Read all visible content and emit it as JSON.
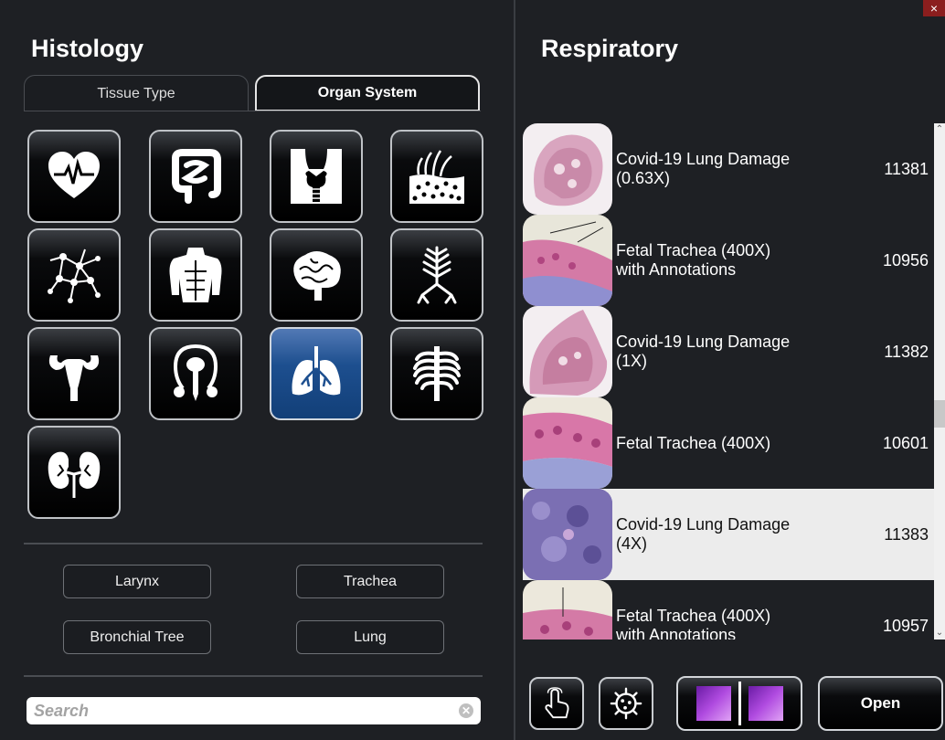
{
  "left": {
    "title": "Histology",
    "tabs": [
      {
        "label": "Tissue Type",
        "active": false
      },
      {
        "label": "Organ System",
        "active": true
      }
    ],
    "organ_systems": [
      {
        "icon": "heart-icon"
      },
      {
        "icon": "intestine-icon"
      },
      {
        "icon": "thyroid-icon"
      },
      {
        "icon": "skin-icon"
      },
      {
        "icon": "lymphatic-icon"
      },
      {
        "icon": "muscle-icon"
      },
      {
        "icon": "brain-icon"
      },
      {
        "icon": "bronchial-tree-icon"
      },
      {
        "icon": "female-reproductive-icon"
      },
      {
        "icon": "male-reproductive-icon"
      },
      {
        "icon": "lungs-icon",
        "selected": true
      },
      {
        "icon": "ribcage-icon"
      },
      {
        "icon": "kidneys-icon"
      }
    ],
    "subcategories": [
      "Larynx",
      "Trachea",
      "Bronchial Tree",
      "Lung"
    ],
    "search": {
      "placeholder": "Search",
      "value": ""
    }
  },
  "right": {
    "title": "Respiratory",
    "close_label": "×",
    "items": [
      {
        "name_line1": "Covid-19 Lung Damage",
        "name_line2": "(0.63X)",
        "id": "11381",
        "thumb": "lung-pink"
      },
      {
        "name_line1": "Fetal Trachea (400X)",
        "name_line2": "with Annotations",
        "id": "10956",
        "thumb": "trachea-annotated"
      },
      {
        "name_line1": "Covid-19 Lung Damage",
        "name_line2": "(1X)",
        "id": "11382",
        "thumb": "lung-pink"
      },
      {
        "name_line1": "Fetal Trachea (400X)",
        "name_line2": "",
        "id": "10601",
        "thumb": "trachea"
      },
      {
        "name_line1": "Covid-19 Lung Damage",
        "name_line2": "(4X)",
        "id": "11383",
        "thumb": "lung-purple",
        "selected": true
      },
      {
        "name_line1": "Fetal Trachea (400X)",
        "name_line2": "with Annotations",
        "id": "10957",
        "thumb": "trachea-annotated-2"
      }
    ],
    "toolbar": {
      "touch_icon": "touch-hand-icon",
      "virus_icon": "virus-icon",
      "compare_icon": "compare-icon",
      "open_label": "Open"
    },
    "colors": {
      "accent_selected": "#1d4f8f",
      "compare_purple": "#9b3fd0"
    }
  }
}
